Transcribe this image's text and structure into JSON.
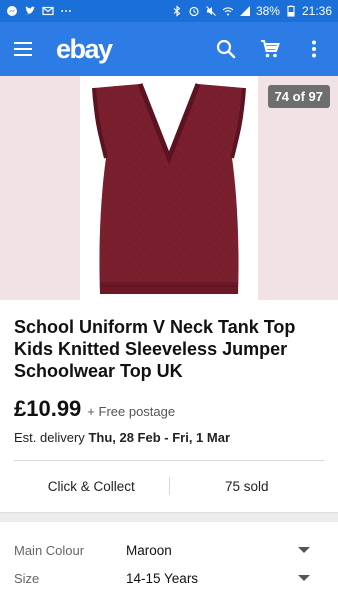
{
  "status_bar": {
    "battery": "38%",
    "time": "21:36"
  },
  "app_bar": {
    "brand": "ebay",
    "icons": [
      "menu-icon",
      "search-icon",
      "cart-icon",
      "more-vert-icon"
    ]
  },
  "gallery": {
    "counter": "74 of 97"
  },
  "listing": {
    "title": "School Uniform V Neck Tank Top Kids Knitted Sleeveless Jumper Schoolwear Top UK",
    "price": "£10.99",
    "postage": "+ Free postage",
    "delivery_prefix": "Est. delivery",
    "delivery_dates": "Thu, 28 Feb - Fri, 1 Mar",
    "click_collect": "Click & Collect",
    "sold": "75 sold"
  },
  "specifics": [
    {
      "label": "Main Colour",
      "value": "Maroon"
    },
    {
      "label": "Size",
      "value": "14-15 Years"
    }
  ],
  "colors": {
    "status_bar": "#1a6fd8",
    "app_bar": "#2d7ce6",
    "garment": "#7a1f2e"
  }
}
